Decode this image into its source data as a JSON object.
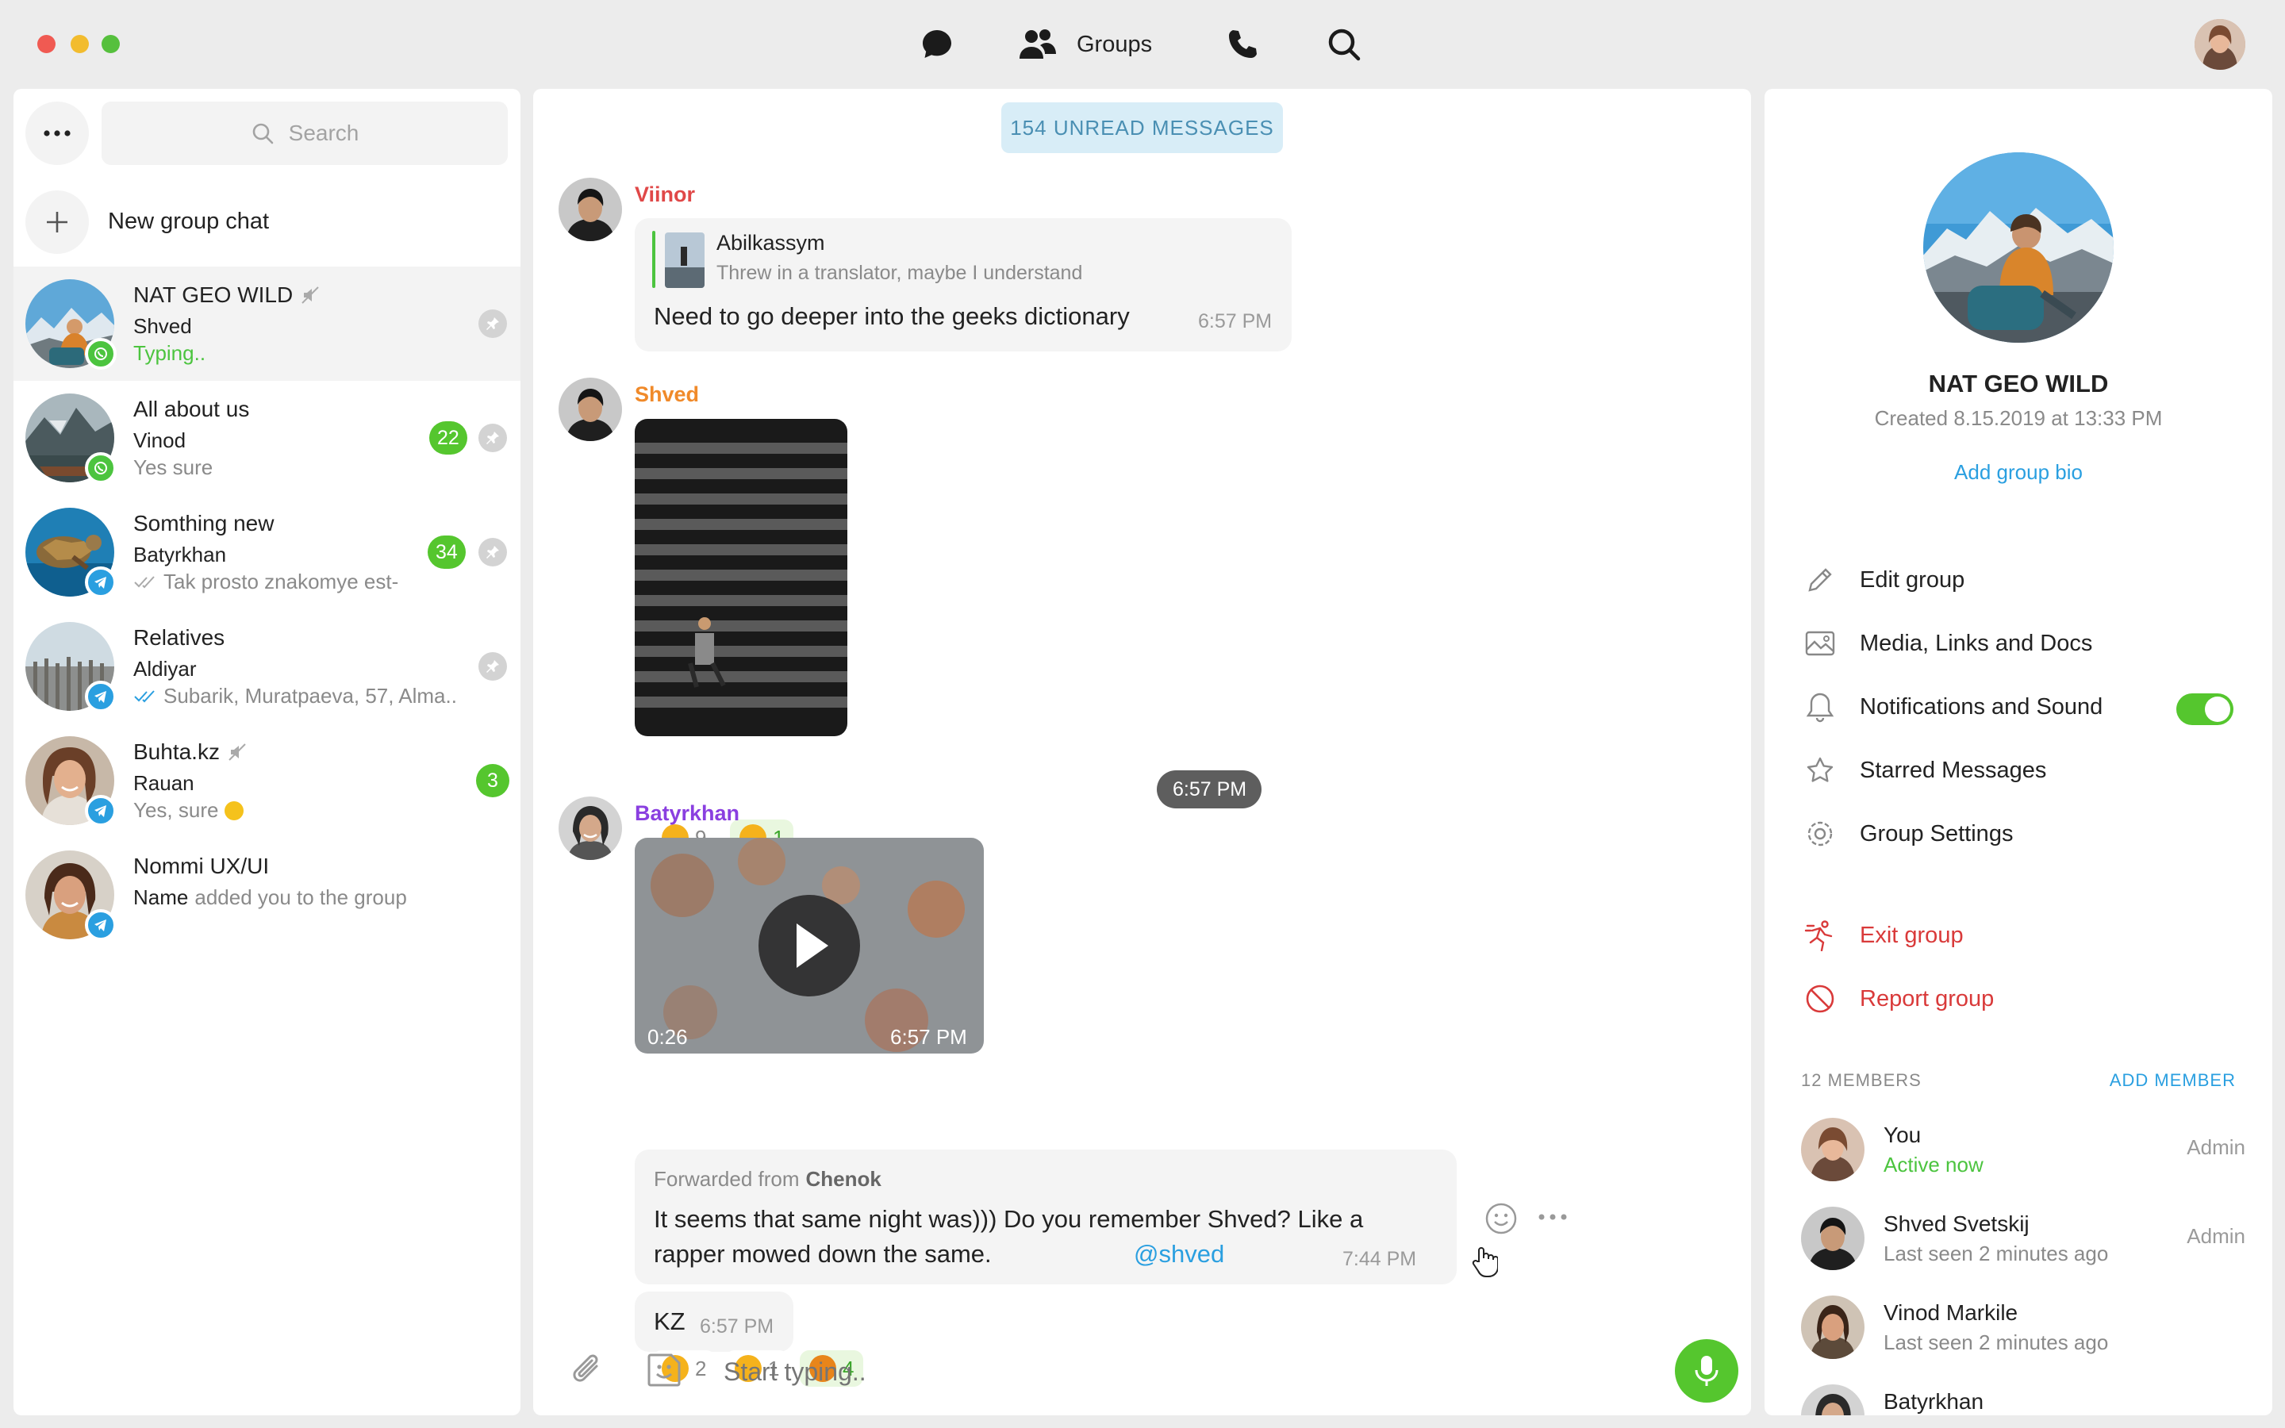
{
  "titlebar": {
    "nav": {
      "groups_label": "Groups"
    },
    "icons": [
      "chat-bubble-icon",
      "groups-icon",
      "phone-icon",
      "search-icon"
    ]
  },
  "sidebar": {
    "search_placeholder": "Search",
    "new_group_label": "New group chat",
    "chats": [
      {
        "title": "NAT GEO WILD",
        "muted": true,
        "sender": "Shved",
        "message": "Typing..",
        "typing": true,
        "badge": "",
        "source": "whatsapp",
        "pinned": true
      },
      {
        "title": "All about us",
        "muted": false,
        "sender": "Vinod",
        "message": "Yes sure",
        "badge": "22",
        "source": "whatsapp",
        "pinned": true
      },
      {
        "title": "Somthing new",
        "muted": false,
        "sender": "Batyrkhan",
        "message": "Tak prosto znakomye est-",
        "read_ticks": "grey",
        "badge": "34",
        "source": "telegram",
        "pinned": true
      },
      {
        "title": "Relatives",
        "muted": false,
        "sender": "Aldiyar",
        "message": "Subarik, Muratpaeva, 57, Alma..",
        "read_ticks": "blue",
        "badge": "",
        "source": "telegram",
        "pinned": true
      },
      {
        "title": "Buhta.kz",
        "muted": true,
        "sender": "Rauan",
        "message": "Yes, sure",
        "badge": "3",
        "source": "telegram",
        "pinned": false
      },
      {
        "title": "Nommi UX/UI",
        "muted": false,
        "sender": "",
        "message_name": "Name",
        "message": "added you to the group",
        "badge": "",
        "source": "telegram",
        "pinned": false
      }
    ]
  },
  "chat": {
    "unread_label": "154 UNREAD MESSAGES",
    "messages": [
      {
        "sender": "Viinor",
        "color": "#e04848",
        "reply_author": "Abilkassym",
        "reply_text": "Threw in a translator, maybe I understand",
        "text": "Need to go deeper into the geeks dictionary",
        "time": "6:57 PM"
      },
      {
        "sender": "Shved",
        "color": "#f08a2a",
        "photo_time": "6:57 PM",
        "reactions": [
          {
            "emoji": "grin",
            "count": "9"
          },
          {
            "emoji": "upside",
            "count": "1",
            "active": true
          }
        ]
      },
      {
        "sender": "Batyrkhan",
        "color": "#8a3fe0",
        "video_duration": "0:26",
        "video_time": "6:57 PM",
        "forward_prefix": "Forwarded from",
        "forward_from": "Chenok",
        "forward_text": "It seems that same night was))) Do you remember Shved? Like a rapper mowed down the same.",
        "mention": "@shved",
        "forward_time": "7:44 PM",
        "short_text": "KZ",
        "short_time": "6:57 PM",
        "reactions": [
          {
            "emoji": "tongue",
            "count": "2"
          },
          {
            "emoji": "cool",
            "count": "1"
          },
          {
            "emoji": "pumpkin",
            "count": "4",
            "active": true
          }
        ]
      }
    ],
    "composer_placeholder": "Start typing.."
  },
  "info": {
    "group_name": "NAT GEO WILD",
    "created": "Created 8.15.2019 at 13:33 PM",
    "add_bio": "Add group bio",
    "menu": [
      {
        "label": "Edit group",
        "icon": "pencil-icon"
      },
      {
        "label": "Media, Links and Docs",
        "icon": "image-icon"
      },
      {
        "label": "Notifications and Sound",
        "icon": "bell-icon",
        "toggle": true
      },
      {
        "label": "Starred Messages",
        "icon": "star-icon"
      },
      {
        "label": "Group Settings",
        "icon": "gear-icon"
      }
    ],
    "danger": [
      {
        "label": "Exit group",
        "icon": "exit-icon"
      },
      {
        "label": "Report group",
        "icon": "block-icon"
      }
    ],
    "members_count": "12 MEMBERS",
    "add_member": "ADD MEMBER",
    "members": [
      {
        "name": "You",
        "status": "Active now",
        "online": true,
        "role": "Admin"
      },
      {
        "name": "Shved Svetskij",
        "status": "Last seen 2 minutes ago",
        "role": "Admin"
      },
      {
        "name": "Vinod Markile",
        "status": "Last seen 2 minutes ago",
        "role": ""
      },
      {
        "name": "Batyrkhan",
        "status": "",
        "role": ""
      }
    ]
  },
  "colors": {
    "accent_green": "#55c62e",
    "link_blue": "#2a9fe0",
    "danger_red": "#d93a3a"
  }
}
